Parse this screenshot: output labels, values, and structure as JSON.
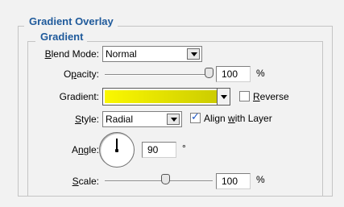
{
  "panel": {
    "section_title": "Gradient Overlay",
    "group_title": "Gradient"
  },
  "blend_mode": {
    "label_pre": "",
    "label_mnemonic": "B",
    "label_post": "lend Mode:",
    "value": "Normal"
  },
  "opacity": {
    "label_pre": "O",
    "label_mnemonic": "p",
    "label_post": "acity:",
    "value": "100",
    "unit": "%",
    "slider_level": 1.0
  },
  "gradient": {
    "label": "Gradient:",
    "color_start": "#fbf800",
    "color_end": "#c8c800",
    "reverse_pre": "",
    "reverse_mnemonic": "R",
    "reverse_post": "everse",
    "reverse_checked": false
  },
  "style": {
    "label_pre": "",
    "label_mnemonic": "S",
    "label_post": "tyle:",
    "value": "Radial",
    "align_pre": "Align ",
    "align_mnemonic": "w",
    "align_post": "ith Layer",
    "align_checked": true
  },
  "angle": {
    "label_pre": "A",
    "label_mnemonic": "n",
    "label_post": "gle:",
    "value": "90",
    "unit": "°"
  },
  "scale": {
    "label_pre": "",
    "label_mnemonic": "S",
    "label_post": "cale:",
    "value": "100",
    "unit": "%",
    "slider_level": 0.5
  },
  "colors": {
    "title_blue": "#1f5a9b",
    "panel_bg": "#f2f2f2"
  }
}
